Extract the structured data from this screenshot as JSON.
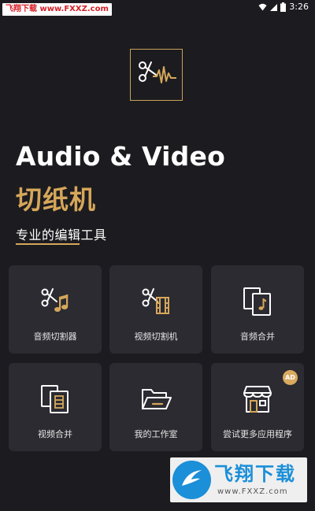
{
  "status_bar": {
    "watermark_text": "飞翔下载 www.FXXZ.com",
    "time": "3:26",
    "icons": [
      "wifi-icon",
      "signal-icon",
      "battery-icon"
    ]
  },
  "hero": {
    "logo_icon": "scissors-waveform-icon",
    "title_en": "Audio & Video",
    "title_cn": "切纸机",
    "subtitle": "专业的编辑工具"
  },
  "features": [
    {
      "label": "音频切割器",
      "icon": "audio-cutter-icon"
    },
    {
      "label": "视频切割机",
      "icon": "video-cutter-icon"
    },
    {
      "label": "音频合并",
      "icon": "audio-merge-icon"
    },
    {
      "label": "视频合并",
      "icon": "video-merge-icon"
    },
    {
      "label": "我的工作室",
      "icon": "folder-icon"
    },
    {
      "label": "尝试更多应用程序",
      "icon": "store-icon",
      "badge": "AD"
    }
  ],
  "watermark": {
    "big_text": "飞翔下载",
    "url_text": "www.FXXZ.com"
  },
  "colors": {
    "background": "#1c1c20",
    "card": "#2b2b31",
    "accent_gold": "#d6a75a"
  }
}
